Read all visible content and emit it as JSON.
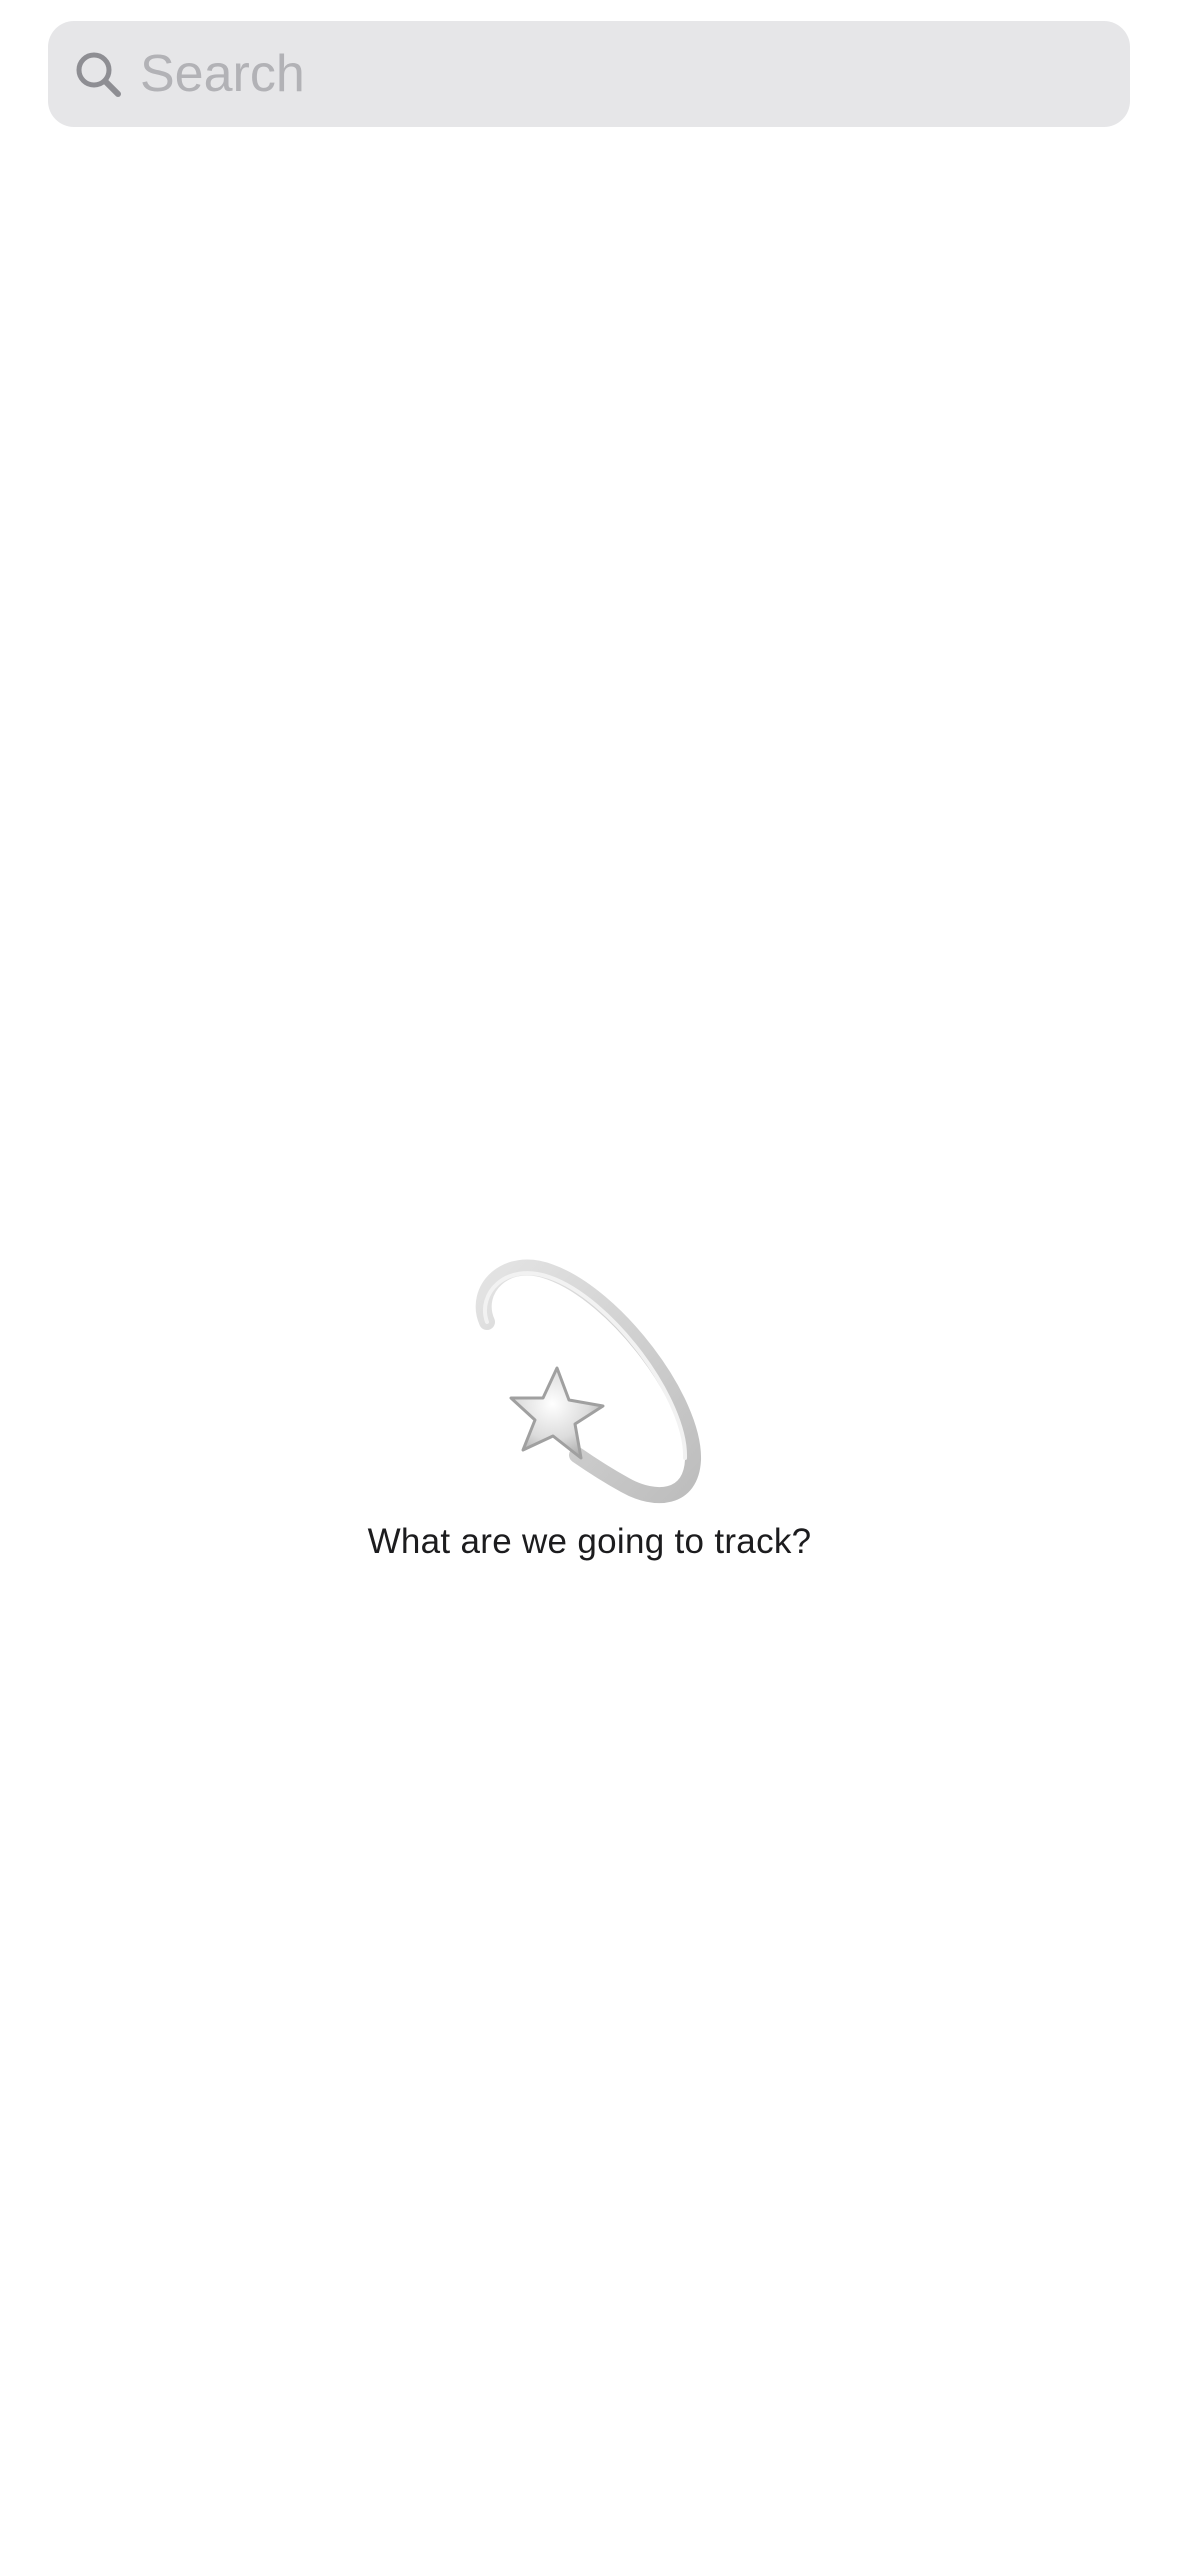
{
  "search": {
    "placeholder": "Search",
    "value": "",
    "icon": "magnifying-glass-icon"
  },
  "empty_state": {
    "icon": "dizzy-star-icon",
    "message": "What are we going to track?"
  },
  "colors": {
    "search_background": "#e6e6e8",
    "placeholder": "#b2b2b6",
    "icon": "#8e8e93",
    "text": "#1c1c1e",
    "background": "#ffffff"
  }
}
